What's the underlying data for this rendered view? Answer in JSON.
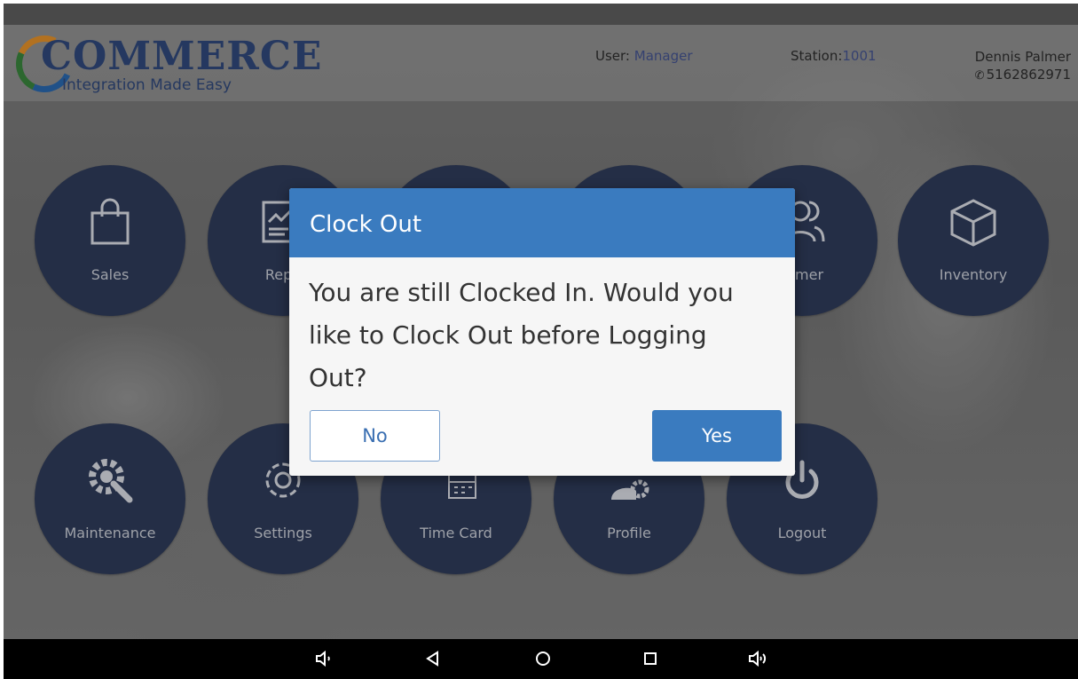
{
  "header": {
    "logo_title": "COMMERCE",
    "logo_subtitle": "Integration Made Easy",
    "user_label": "User:",
    "user_value": "Manager",
    "station_label": "Station:",
    "station_value": "1001",
    "contact_name": "Dennis Palmer",
    "contact_phone": "5162862971"
  },
  "tiles": [
    {
      "label": "Sales",
      "icon": "shopping-bag-icon"
    },
    {
      "label": "Repo",
      "icon": "reports-icon"
    },
    {
      "label": "",
      "icon": ""
    },
    {
      "label": "",
      "icon": ""
    },
    {
      "label": "tomer",
      "icon": "customers-icon"
    },
    {
      "label": "Inventory",
      "icon": "box-icon"
    },
    {
      "label": "Maintenance",
      "icon": "maintenance-gears-icon"
    },
    {
      "label": "Settings",
      "icon": "gear-icon"
    },
    {
      "label": "Time Card",
      "icon": "calendar-icon"
    },
    {
      "label": "Profile",
      "icon": "user-gear-icon"
    },
    {
      "label": "Logout",
      "icon": "power-icon"
    }
  ],
  "dialog": {
    "title": "Clock Out",
    "message": "You are still Clocked In. Would you like to Clock Out before Logging Out?",
    "no_label": "No",
    "yes_label": "Yes"
  },
  "navbar": {
    "icons": [
      "volume-down-icon",
      "back-icon",
      "home-icon",
      "recents-icon",
      "volume-up-icon"
    ]
  },
  "colors": {
    "tile_bg": "#233051",
    "dialog_header": "#3a7bbf",
    "brand_navy": "#243e73"
  }
}
